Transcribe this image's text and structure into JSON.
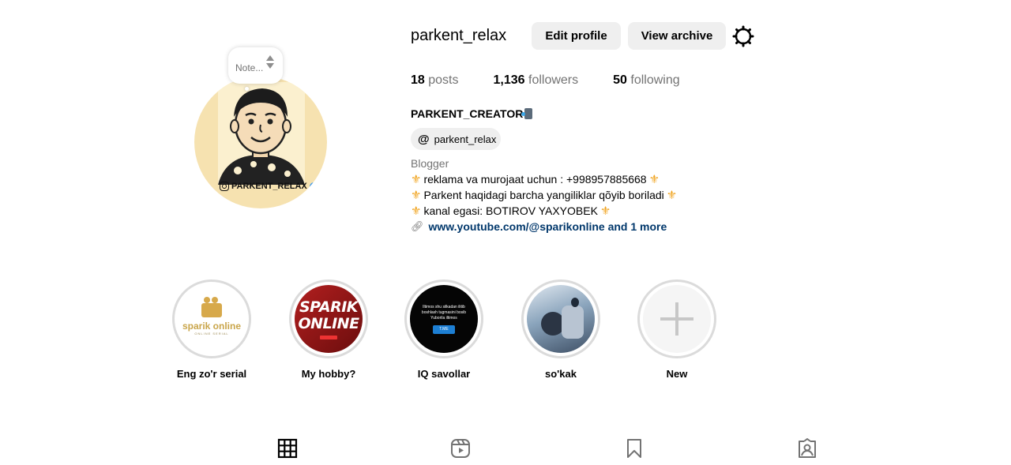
{
  "profile": {
    "username": "parkent_relax",
    "edit_profile_label": "Edit profile",
    "view_archive_label": "View archive",
    "settings_icon": "gear-icon",
    "note_placeholder": "Note...",
    "avatar_tag": "PARKENT_RELAX"
  },
  "stats": {
    "posts_count": "18",
    "posts_label": "posts",
    "followers_count": "1,136",
    "followers_label": "followers",
    "following_count": "50",
    "following_label": "following"
  },
  "bio": {
    "full_name": "PARKENT_CREATOR",
    "threads_handle": "parkent_relax",
    "category": "Blogger",
    "line1": "reklama va murojaat uchun : +998957885668",
    "line2": "Parkent haqidagi barcha yangiliklar qõyib boriladi",
    "line3": "kanal egasi: BOTIROV YAXYOBEK",
    "link_text": "www.youtube.com/@sparikonline and 1 more",
    "accent_color": "#f0a21b",
    "link_color": "#00376b"
  },
  "highlights": [
    {
      "label": "Eng zo'r serial",
      "cover_text": "sparik online",
      "cover_sub": "ONLINE SERIAL"
    },
    {
      "label": "My hobby?",
      "cover_text": "SPARIK ONLINE",
      "cover_sub": ""
    },
    {
      "label": "IQ savollar",
      "cover_text": "Iltimos shu silkadan ilitib boshlash tugmasini bosib Yuborila iltimos",
      "cover_sub": "T.ME"
    },
    {
      "label": "so'kak",
      "cover_text": "",
      "cover_sub": ""
    },
    {
      "label": "New",
      "cover_text": "",
      "cover_sub": ""
    }
  ],
  "tabs": [
    {
      "icon": "grid-icon"
    },
    {
      "icon": "reels-icon"
    },
    {
      "icon": "saved-bookmark-icon"
    },
    {
      "icon": "tagged-icon"
    }
  ]
}
